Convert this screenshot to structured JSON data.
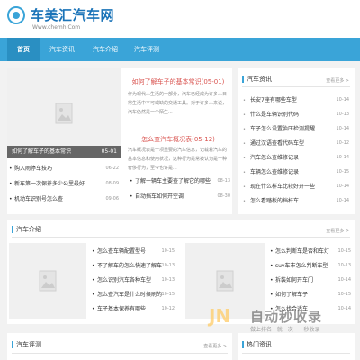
{
  "site": {
    "title": "车美汇汽车网",
    "subtitle": "Www.chemh.Com"
  },
  "nav": [
    "首页",
    "汽车资讯",
    "汽车介绍",
    "汽车评测"
  ],
  "featured": {
    "image_caption": "如何了解车子的基本常识",
    "image_date": "05-01",
    "list": [
      {
        "title": "购入雨停车技巧",
        "date": "06-22"
      },
      {
        "title": "新车第一次保养多少公里最好",
        "date": "08-09"
      },
      {
        "title": "机动车识别号怎么查",
        "date": "09-06"
      }
    ]
  },
  "articles": [
    {
      "title": "如何了解车子的基本常识(05-01)",
      "body": "作为现代人生活的一部分，汽车已经成为许多人日常生活中不可或缺的交通工具。对于许多人来说，汽车仍然是一个陌生..."
    },
    {
      "title": "怎么查汽车概况表(05-12)",
      "body": "汽车概况表是一项重要的汽车信息，记载着汽车的基本信息和使用状况，这种行为是常被认为是一种奢侈行为，至今也许是..."
    }
  ],
  "middle_list": [
    {
      "title": "了解一辆车主要查了解它的哪些",
      "date": "08-13"
    },
    {
      "title": "自动挡车如何开空调",
      "date": "08-30"
    }
  ],
  "news": {
    "title": "汽车资讯",
    "more": "查看更多 >",
    "items": [
      {
        "title": "长安7座有哪些车型",
        "date": "10-14"
      },
      {
        "title": "什么是车辆识别代码",
        "date": "10-13"
      },
      {
        "title": "车子怎么设置胎压检测提醒",
        "date": "10-14"
      },
      {
        "title": "通过汉语查看代码车型",
        "date": "10-12"
      },
      {
        "title": "汽车怎么查维修记录",
        "date": "10-14"
      },
      {
        "title": "车辆怎么查维修记录",
        "date": "10-15"
      },
      {
        "title": "现在什么样车比较好开一些",
        "date": "10-14"
      },
      {
        "title": "怎么看踏板的挡杆车",
        "date": "10-14"
      }
    ]
  },
  "intro": {
    "title": "汽车介绍",
    "more": "查看更多 >",
    "left": [
      {
        "title": "怎么查车辆配置型号",
        "date": "10-15"
      },
      {
        "title": "不了解车的怎么快速了解车",
        "date": "10-13"
      },
      {
        "title": "怎么识别汽车各种车型",
        "date": "10-13"
      },
      {
        "title": "怎么查汽车是什么时候刷的",
        "date": "10-15"
      },
      {
        "title": "车子基本保养有哪些",
        "date": "10-12"
      }
    ],
    "right": [
      {
        "title": "怎么判断车是否和车灯",
        "date": "10-15"
      },
      {
        "title": "suv车市怎么判断车型",
        "date": "10-13"
      },
      {
        "title": "拆装如何开车门",
        "date": "10-14"
      },
      {
        "title": "如何了解车子",
        "date": "10-15"
      },
      {
        "title": "怎么找合适车",
        "date": "10-14"
      }
    ]
  },
  "bottom": {
    "left_title": "汽车评测",
    "left_more": "查看更多 >",
    "right_title": "热门资讯"
  },
  "watermark": {
    "logo": "JN",
    "text": "自动秒收录",
    "sub": "做上排名 · 就一次 · 一秒收录"
  }
}
